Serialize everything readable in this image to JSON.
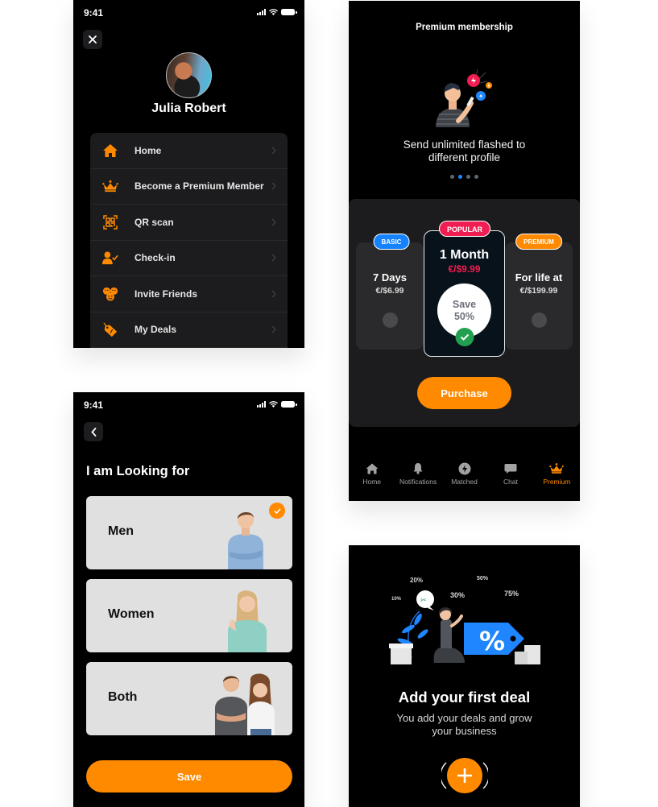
{
  "theme": {
    "accent": "#FF8A00",
    "popular": "#F01D52",
    "basic": "#1583FF",
    "success": "#23A04F",
    "panel": "#1C1C1E",
    "background": "#000000"
  },
  "status_bar": {
    "time": "9:41",
    "icons": [
      "signal-icon",
      "wifi-icon",
      "battery-icon"
    ]
  },
  "side_menu_screen": {
    "close_icon": "close-icon",
    "profile": {
      "name": "Julia Robert",
      "avatar": "profile-photo"
    },
    "items": [
      {
        "label": "Home",
        "icon": "home-icon"
      },
      {
        "label": "Become a Premium Member",
        "icon": "crown-icon"
      },
      {
        "label": "QR scan",
        "icon": "qr-code-icon"
      },
      {
        "label": "Check-in",
        "icon": "user-check-icon"
      },
      {
        "label": "Invite Friends",
        "icon": "friends-icon"
      },
      {
        "label": "My Deals",
        "icon": "tag-icon"
      }
    ]
  },
  "premium_screen": {
    "title": "Premium membership",
    "carousel": {
      "caption": "Send unlimited flashed to different profile",
      "total_slides": 4,
      "active_slide": 2
    },
    "plans": [
      {
        "badge": "BASIC",
        "name": "7 Days",
        "price": "€/$6.99",
        "selected": false
      },
      {
        "badge": "POPULAR",
        "name": "1 Month",
        "price": "€/$9.99",
        "save_line1": "Save",
        "save_line2": "50%",
        "selected": true
      },
      {
        "badge": "PREMIUM",
        "name": "For life at",
        "price": "€/$199.99",
        "selected": false
      }
    ],
    "purchase_label": "Purchase",
    "tabs": [
      {
        "label": "Home",
        "icon": "home-icon",
        "active": false
      },
      {
        "label": "Notifications",
        "icon": "bell-icon",
        "active": false
      },
      {
        "label": "Matched",
        "icon": "flash-icon",
        "active": false
      },
      {
        "label": "Chat",
        "icon": "chat-icon",
        "active": false
      },
      {
        "label": "Premium",
        "icon": "crown-icon",
        "active": true
      }
    ]
  },
  "looking_for_screen": {
    "back_icon": "back-icon",
    "title": "I am Looking for",
    "options": [
      {
        "label": "Men",
        "selected": true
      },
      {
        "label": "Women",
        "selected": false
      },
      {
        "label": "Both",
        "selected": false
      }
    ],
    "save_label": "Save"
  },
  "deals_screen": {
    "illustration_labels": [
      "20%",
      "50%",
      "10%",
      "30%",
      "75%",
      "%"
    ],
    "title": "Add your first deal",
    "subtitle": "You add your deals and grow your business",
    "add_icon": "plus-icon"
  }
}
